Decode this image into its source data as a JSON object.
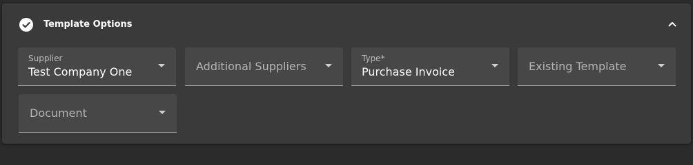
{
  "header": {
    "title": "Template Options",
    "check_icon": "check-circle-icon",
    "collapse_icon": "chevron-up-icon"
  },
  "fields": {
    "supplier": {
      "label": "Supplier",
      "value": "Test Company One"
    },
    "additional_suppliers": {
      "placeholder": "Additional Suppliers"
    },
    "type": {
      "label": "Type*",
      "value": "Purchase Invoice"
    },
    "existing_template": {
      "placeholder": "Existing Template"
    },
    "document": {
      "placeholder": "Document"
    }
  },
  "colors": {
    "background": "#2b2b2b",
    "panel": "#3a3a3a",
    "field": "#474747",
    "text": "#ffffff",
    "muted_text": "#b4b4b4"
  }
}
